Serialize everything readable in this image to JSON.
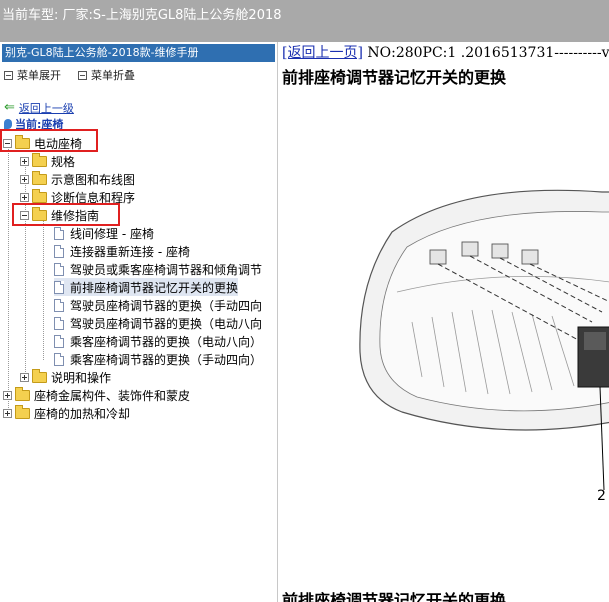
{
  "window": {
    "title": "当前车型:  厂家:S-上海别克GL8陆上公务舱2018"
  },
  "left": {
    "manual_title": "别克-GL8陆上公务舱-2018款-维修手册",
    "expand_all": "菜单展开",
    "collapse_all": "菜单折叠",
    "back_link": "返回上一级",
    "current_label": "当前:座椅",
    "tree": {
      "root": "电动座椅",
      "specs": "规格",
      "diagrams": "示意图和布线图",
      "diagnostics": "诊断信息和程序",
      "repair": "维修指南",
      "repair_items": [
        "线间修理 - 座椅",
        "连接器重新连接 - 座椅",
        "驾驶员或乘客座椅调节器和倾角调节",
        "前排座椅调节器记忆开关的更换",
        "驾驶员座椅调节器的更换（手动四向",
        "驾驶员座椅调节器的更换（电动八向",
        "乘客座椅调节器的更换（电动八向）",
        "乘客座椅调节器的更换（手动四向）"
      ],
      "description": "说明和操作",
      "metal": "座椅金属构件、装饰件和蒙皮",
      "heating": "座椅的加热和冷却"
    }
  },
  "content": {
    "back_link": "[返回上一页]",
    "doc_id": " NO:280PC:1 .2016513731----------v",
    "title": "前排座椅调节器记忆开关的更换",
    "bottom_title": "前排座椅调节器记忆开关的更换",
    "callout": "2"
  }
}
